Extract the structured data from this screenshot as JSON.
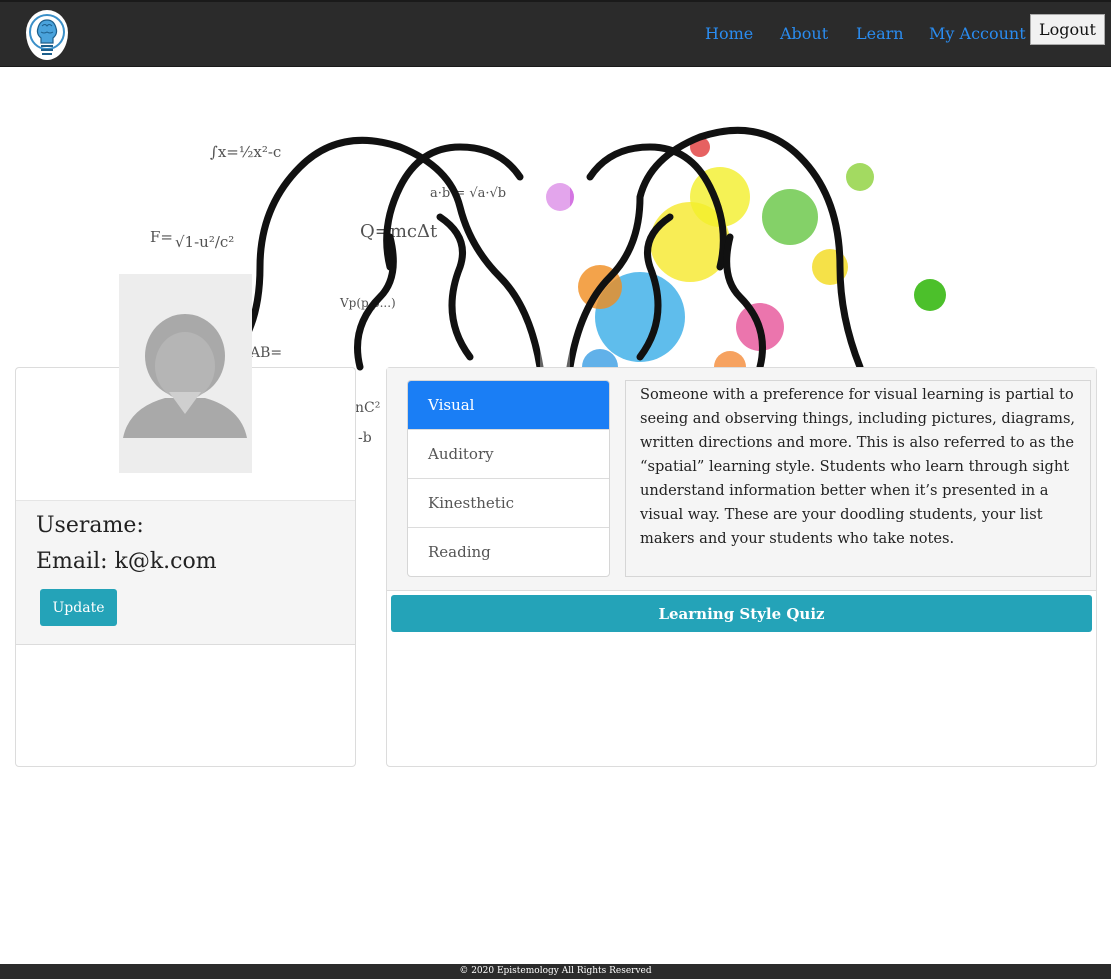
{
  "nav": {
    "links": [
      {
        "label": "Home"
      },
      {
        "label": "About"
      },
      {
        "label": "Learn"
      },
      {
        "label": "My Account"
      }
    ],
    "logout_label": "Logout",
    "link_color": "#2a8cf0"
  },
  "profile": {
    "username_label": "Userame:",
    "email_line": "Email: k@k.com",
    "update_label": "Update"
  },
  "learning_styles": {
    "tabs": [
      {
        "label": "Visual",
        "active": true
      },
      {
        "label": "Auditory",
        "active": false
      },
      {
        "label": "Kinesthetic",
        "active": false
      },
      {
        "label": "Reading",
        "active": false
      }
    ],
    "description": "Someone with a preference for visual learning is partial to seeing and observing things, including pictures, diagrams, written directions and more. This is also referred to as the “spatial” learning style. Students who learn through sight understand information better when it’s presented in a visual way. These are your doodling students, your list makers and your students who take notes.",
    "quiz_label": "Learning Style Quiz",
    "active_color": "#1a7ef5",
    "button_color": "#24a3b8"
  },
  "footer": {
    "text": "© 2020 Epistemology All Rights Reserved"
  }
}
